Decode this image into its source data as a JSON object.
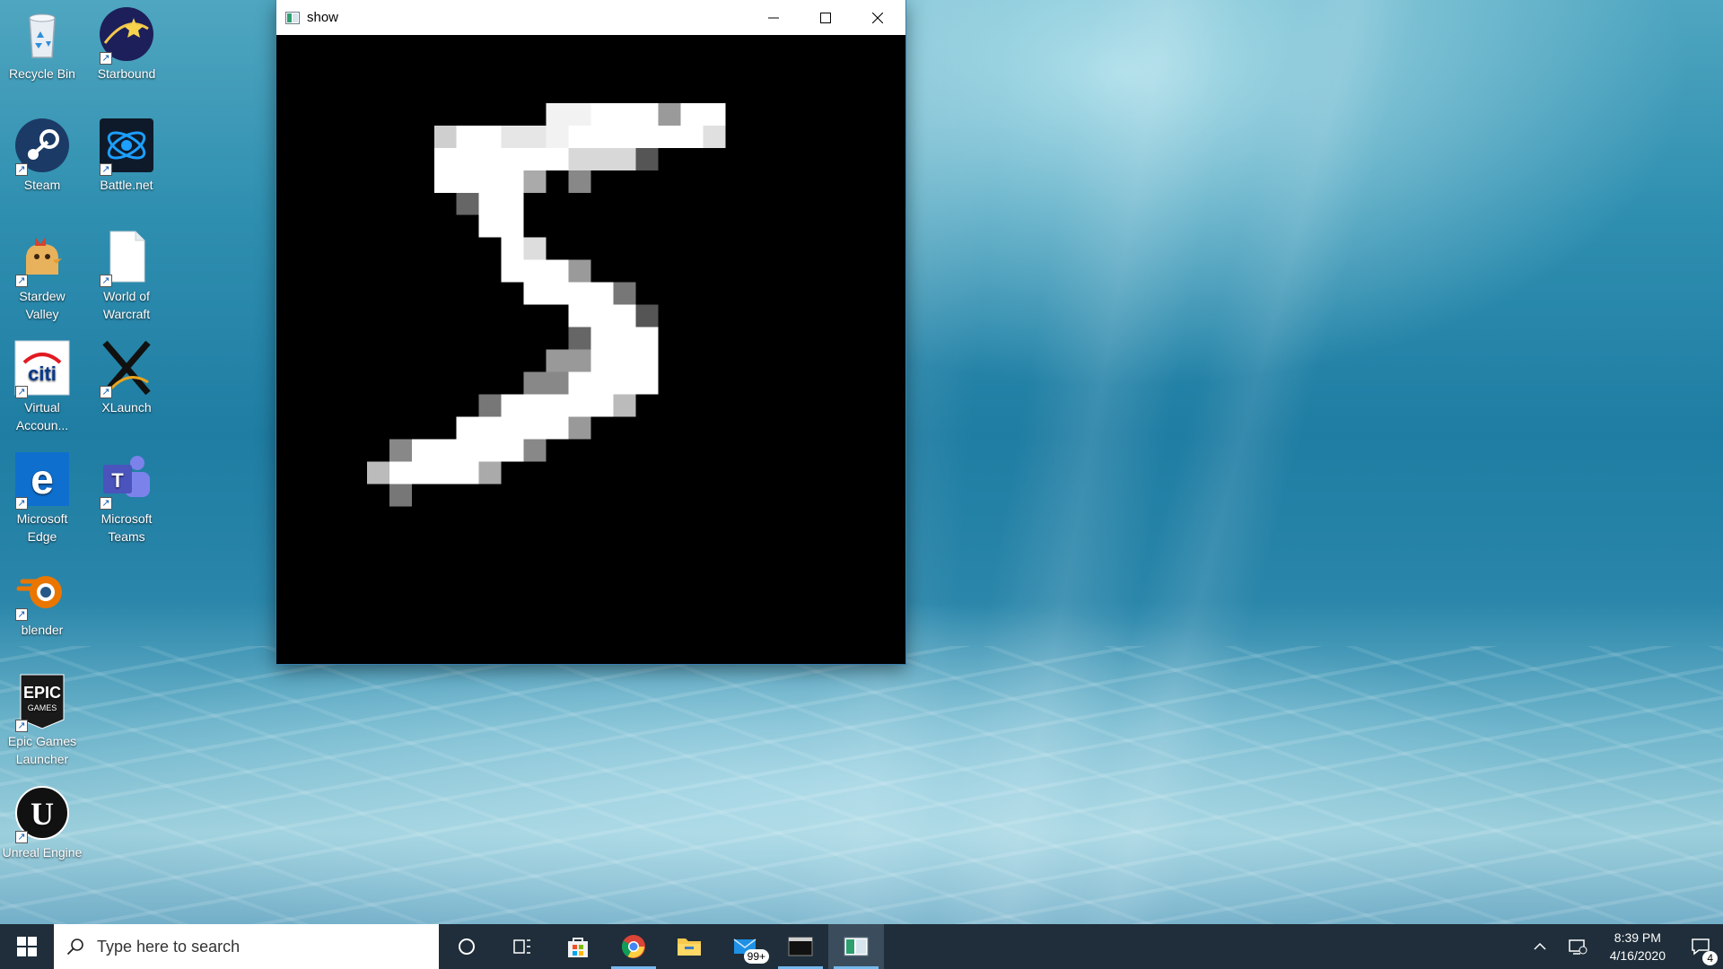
{
  "desktop": {
    "icons": [
      {
        "label": "Recycle Bin",
        "icon": "recycle-bin-icon"
      },
      {
        "label": "Starbound",
        "icon": "starbound-icon"
      },
      {
        "label": "Steam",
        "icon": "steam-icon"
      },
      {
        "label": "Battle.net",
        "icon": "battlenet-icon"
      },
      {
        "label": "Stardew Valley",
        "icon": "stardew-valley-icon"
      },
      {
        "label": "World of Warcraft",
        "icon": "document-icon"
      },
      {
        "label": "Virtual Accoun...",
        "icon": "citi-icon"
      },
      {
        "label": "XLaunch",
        "icon": "xlaunch-icon"
      },
      {
        "label": "Microsoft Edge",
        "icon": "edge-icon"
      },
      {
        "label": "Microsoft Teams",
        "icon": "teams-icon"
      },
      {
        "label": "blender",
        "icon": "blender-icon"
      },
      {
        "label": "Epic Games Launcher",
        "icon": "epic-games-icon"
      },
      {
        "label": "Unreal Engine",
        "icon": "unreal-engine-icon"
      }
    ]
  },
  "window": {
    "title": "show",
    "content": "digit-5-image"
  },
  "taskbar": {
    "search_placeholder": "Type here to search",
    "mail_badge": "99+",
    "clock_time": "8:39 PM",
    "clock_date": "4/16/2020",
    "notification_count": "4"
  },
  "colors": {
    "taskbar_bg": "#1f2e3a",
    "titlebar_bg": "#ffffff",
    "accent": "#76b9ed"
  }
}
